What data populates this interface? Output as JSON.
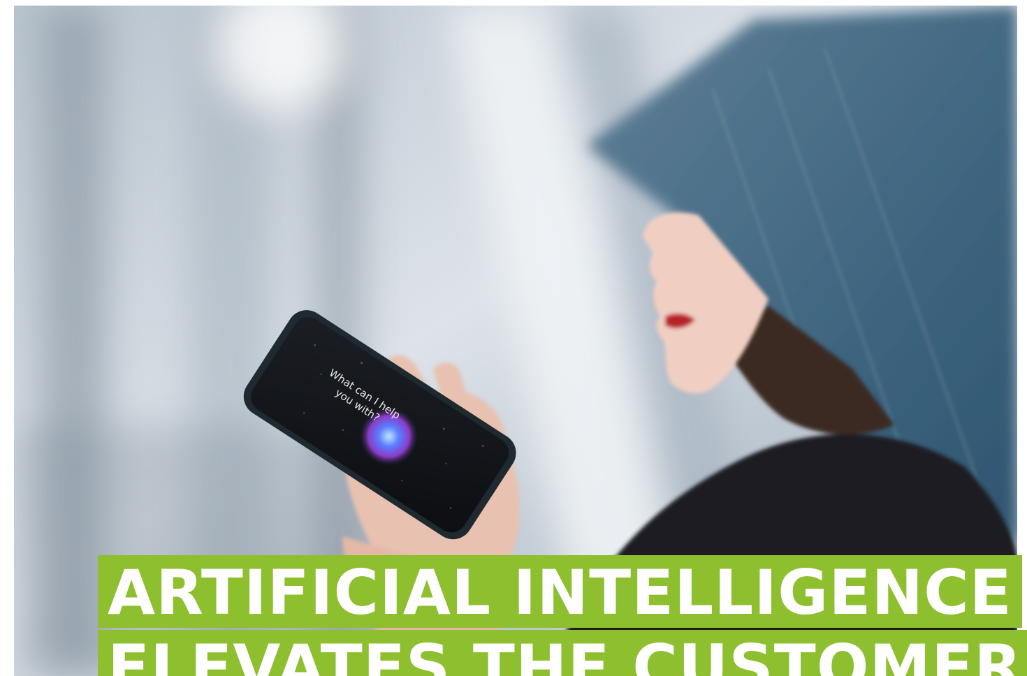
{
  "headline": {
    "line1": "ARTIFICIAL INTELLIGENCE",
    "line2": "ELEVATES THE CUSTOMER"
  },
  "phone_screen": {
    "line1": "What can I help",
    "line2": "you with?"
  },
  "colors": {
    "headline_bg": "#8dbf2e",
    "headline_text": "#ffffff"
  }
}
